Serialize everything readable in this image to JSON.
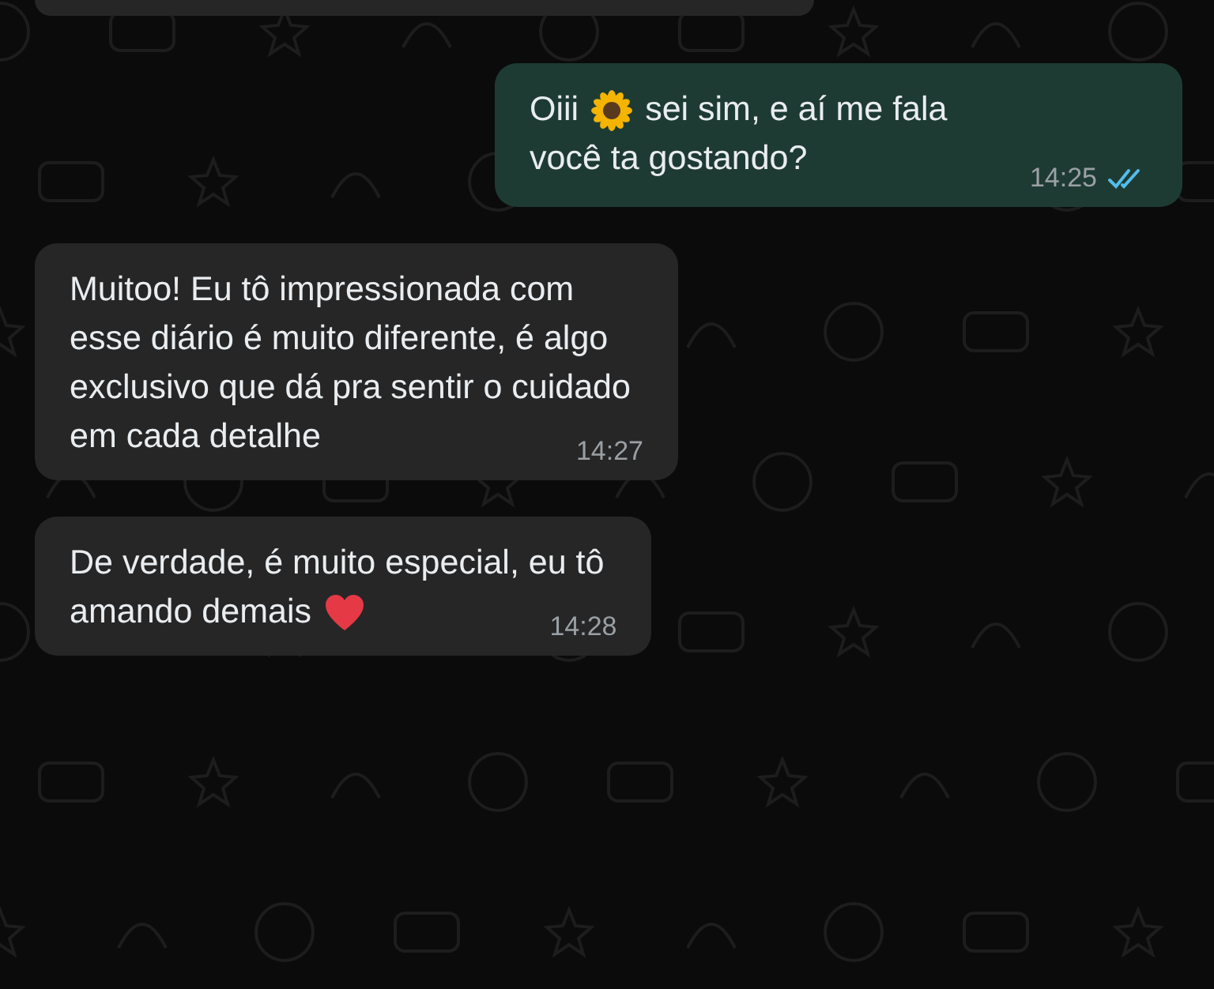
{
  "messages": [
    {
      "outgoing": false
    },
    {
      "outgoing": true,
      "lines": [
        [
          {
            "kind": "text",
            "text": "Oiii"
          },
          {
            "kind": "sunflower"
          },
          {
            "kind": "text",
            "text": "sei sim, e aí me fala"
          }
        ],
        [
          {
            "kind": "text",
            "text": "você ta gostando?"
          }
        ]
      ],
      "time": "14:25",
      "read": true
    },
    {
      "outgoing": false,
      "lines": [
        [
          {
            "kind": "text",
            "text": "Muitoo! Eu tô impressionada com"
          }
        ],
        [
          {
            "kind": "text",
            "text": "esse diário é muito diferente, é algo"
          }
        ],
        [
          {
            "kind": "text",
            "text": "exclusivo que dá pra sentir o cuidado"
          }
        ],
        [
          {
            "kind": "text",
            "text": "em cada detalhe"
          }
        ]
      ],
      "time": "14:27"
    },
    {
      "outgoing": false,
      "lines": [
        [
          {
            "kind": "text",
            "text": "De verdade, é muito especial, eu tô"
          }
        ],
        [
          {
            "kind": "text",
            "text": "amando demais"
          },
          {
            "kind": "heart"
          }
        ]
      ],
      "time": "14:28"
    }
  ]
}
